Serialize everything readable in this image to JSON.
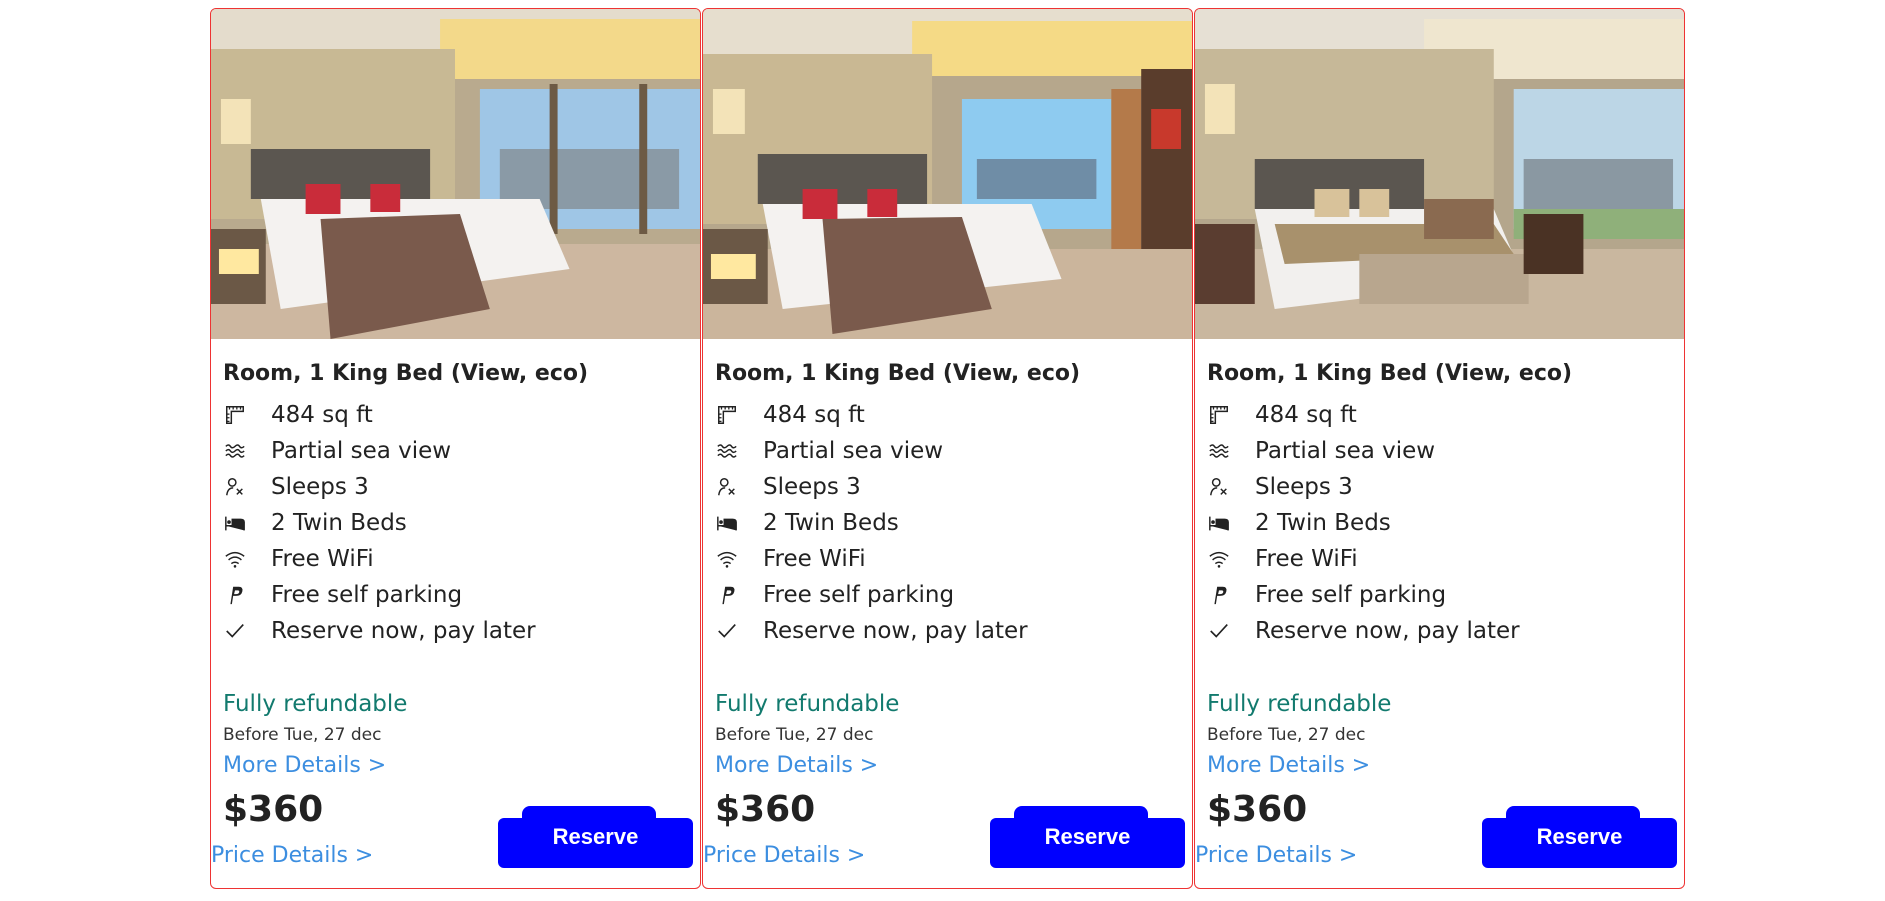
{
  "accent_color": "#0000ff",
  "refund_color": "#127a6e",
  "link_color": "#3c8ee0",
  "border_color": "#e33333",
  "cards": [
    {
      "title": "Room, 1 King Bed (View, eco)",
      "features": [
        {
          "icon": "floor-plan-icon",
          "text": "484 sq ft"
        },
        {
          "icon": "waves-icon",
          "text": "Partial sea view"
        },
        {
          "icon": "people-icon",
          "text": "Sleeps 3"
        },
        {
          "icon": "bed-icon",
          "text": "2 Twin Beds"
        },
        {
          "icon": "wifi-icon",
          "text": "Free WiFi"
        },
        {
          "icon": "parking-icon",
          "text": "Free self parking"
        },
        {
          "icon": "check-icon",
          "text": "Reserve now, pay later"
        }
      ],
      "refund": "Fully refundable",
      "before": "Before Tue, 27 dec",
      "more_details": "More Details >",
      "price": "$360",
      "price_details": "Price Details >",
      "reserve": "Reserve"
    },
    {
      "title": "Room, 1 King Bed (View, eco)",
      "features": [
        {
          "icon": "floor-plan-icon",
          "text": "484 sq ft"
        },
        {
          "icon": "waves-icon",
          "text": "Partial sea view"
        },
        {
          "icon": "people-icon",
          "text": "Sleeps 3"
        },
        {
          "icon": "bed-icon",
          "text": "2 Twin Beds"
        },
        {
          "icon": "wifi-icon",
          "text": "Free WiFi"
        },
        {
          "icon": "parking-icon",
          "text": "Free self parking"
        },
        {
          "icon": "check-icon",
          "text": "Reserve now, pay later"
        }
      ],
      "refund": "Fully refundable",
      "before": "Before Tue, 27 dec",
      "more_details": "More Details >",
      "price": "$360",
      "price_details": "Price Details >",
      "reserve": "Reserve"
    },
    {
      "title": "Room, 1 King Bed (View, eco)",
      "features": [
        {
          "icon": "floor-plan-icon",
          "text": "484 sq ft"
        },
        {
          "icon": "waves-icon",
          "text": "Partial sea view"
        },
        {
          "icon": "people-icon",
          "text": "Sleeps 3"
        },
        {
          "icon": "bed-icon",
          "text": "2 Twin Beds"
        },
        {
          "icon": "wifi-icon",
          "text": "Free WiFi"
        },
        {
          "icon": "parking-icon",
          "text": "Free self parking"
        },
        {
          "icon": "check-icon",
          "text": "Reserve now, pay later"
        }
      ],
      "refund": "Fully refundable",
      "before": "Before Tue, 27 dec",
      "more_details": "More Details >",
      "price": "$360",
      "price_details": "Price Details >",
      "reserve": "Reserve"
    }
  ]
}
